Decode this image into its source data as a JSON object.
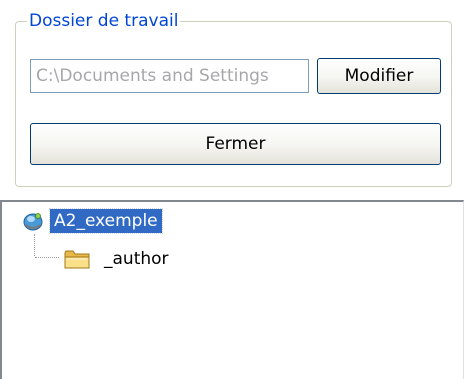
{
  "working_folder": {
    "title": "Dossier de travail",
    "path_value": "C:\\Documents and Settings",
    "modify_label": "Modifier",
    "close_label": "Fermer"
  },
  "tree": {
    "root": {
      "label": "A2_exemple",
      "icon": "project-icon",
      "selected": true
    },
    "children": [
      {
        "label": "_author",
        "icon": "folder-icon"
      }
    ]
  },
  "colors": {
    "group_title": "#0046d5",
    "selection": "#316ac5",
    "disabled_text": "#a7a6aa",
    "button_border": "#003c74"
  }
}
